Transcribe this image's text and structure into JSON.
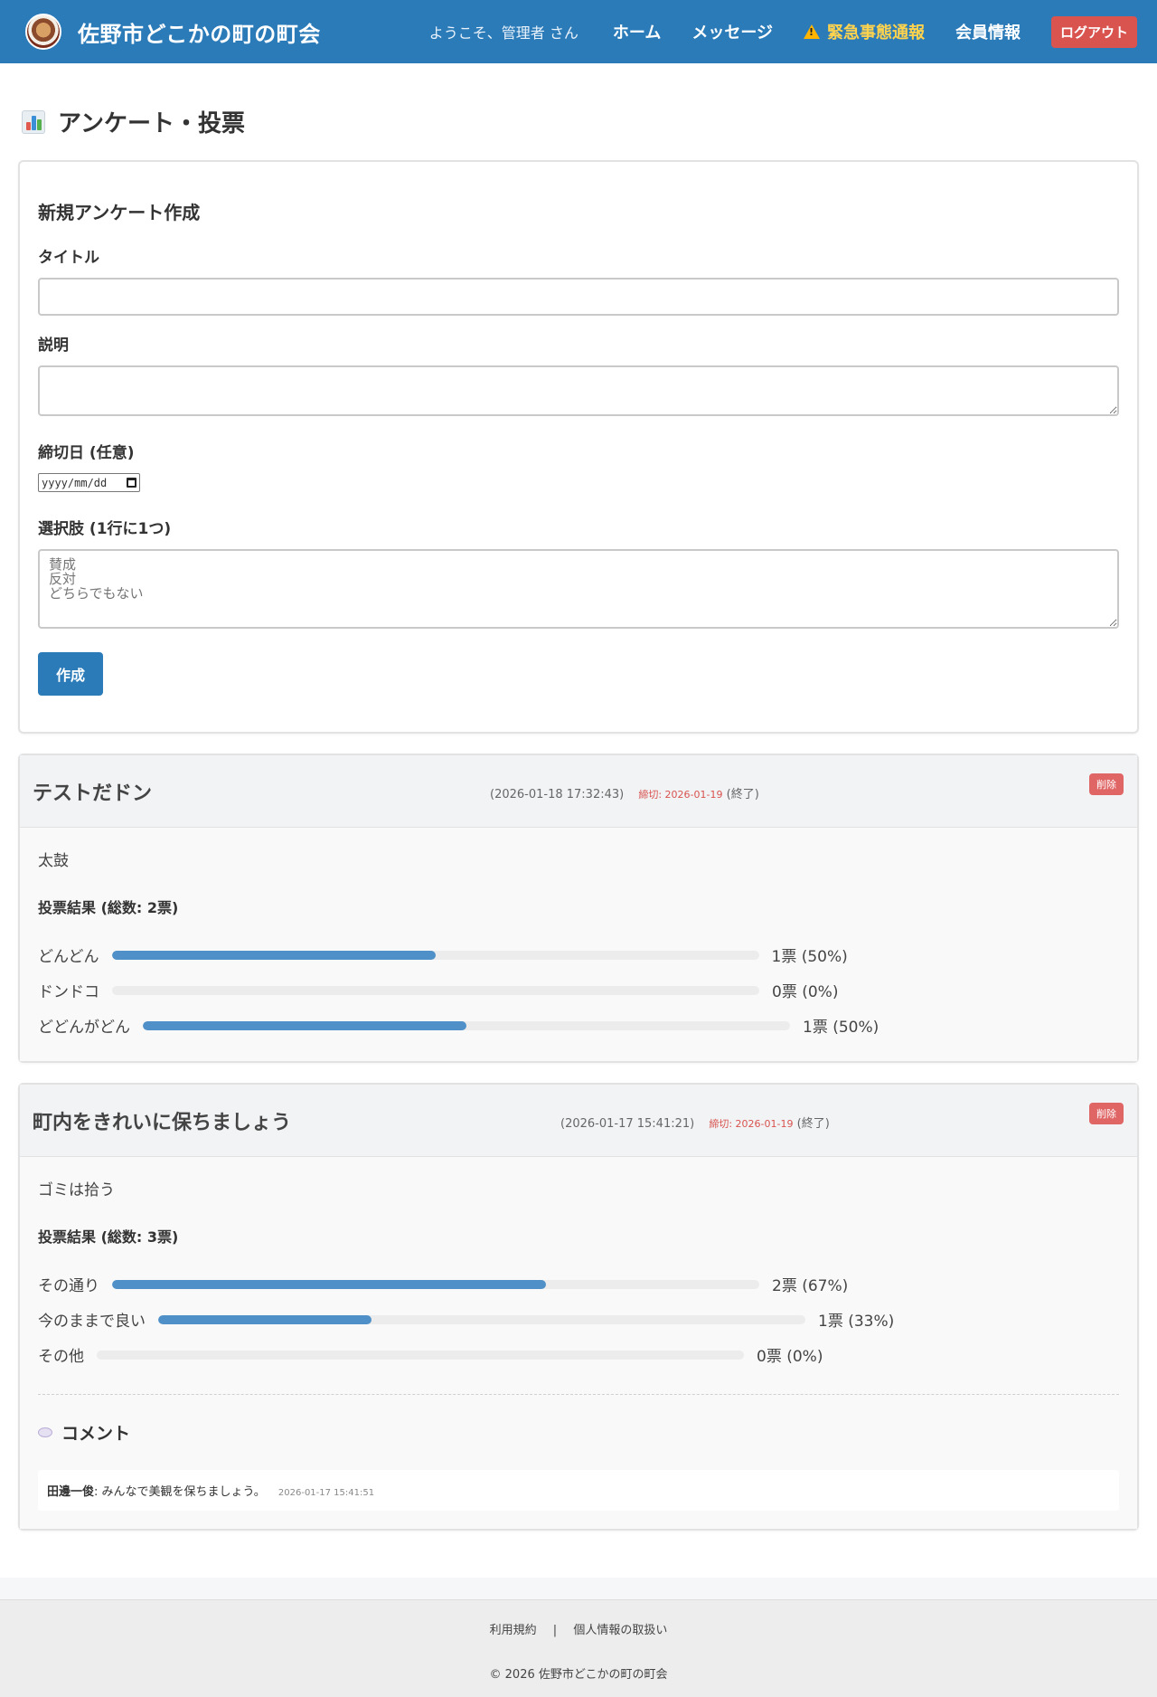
{
  "header": {
    "site_title": "佐野市どこかの町の町会",
    "welcome": "ようこそ、管理者 さん",
    "nav": {
      "home": "ホーム",
      "messages": "メッセージ",
      "emergency": "緊急事態通報",
      "members": "会員情報",
      "logout": "ログアウト"
    }
  },
  "page": {
    "title": "アンケート・投票"
  },
  "form": {
    "heading": "新規アンケート作成",
    "title_label": "タイトル",
    "title_value": "",
    "desc_label": "説明",
    "desc_value": "",
    "deadline_label": "締切日 (任意)",
    "deadline_placeholder": "yyyy/mm/dd",
    "options_label": "選択肢 (1行に1つ)",
    "options_placeholder": "賛成\n反対\nどちらでもない",
    "submit_label": "作成"
  },
  "polls": [
    {
      "title": "テストだドン",
      "created": "(2026-01-18 17:32:43)",
      "deadline": "締切: 2026-01-19",
      "status": "(終了)",
      "delete_label": "削除",
      "description": "太鼓",
      "results_heading": "投票結果 (総数: 2票)",
      "results": [
        {
          "label": "どんどん",
          "value_text": "1票 (50%)",
          "percent": 50
        },
        {
          "label": "ドンドコ",
          "value_text": "0票 (0%)",
          "percent": 0
        },
        {
          "label": "どどんがどん",
          "value_text": "1票 (50%)",
          "percent": 50
        }
      ]
    },
    {
      "title": "町内をきれいに保ちましょう",
      "created": "(2026-01-17 15:41:21)",
      "deadline": "締切: 2026-01-19",
      "status": "(終了)",
      "delete_label": "削除",
      "description": "ゴミは拾う",
      "results_heading": "投票結果 (総数: 3票)",
      "results": [
        {
          "label": "その通り",
          "value_text": "2票 (67%)",
          "percent": 67
        },
        {
          "label": "今のままで良い",
          "value_text": "1票 (33%)",
          "percent": 33
        },
        {
          "label": "その他",
          "value_text": "0票 (0%)",
          "percent": 0
        }
      ],
      "comments_heading": "コメント",
      "comments": [
        {
          "author": "田邊一俊",
          "text": ": みんなで美観を保ちましょう。",
          "time": "2026-01-17 15:41:51"
        }
      ]
    }
  ],
  "footer": {
    "terms": "利用規約",
    "separator": "|",
    "privacy": "個人情報の取扱い",
    "copyright": "© 2026 佐野市どこかの町の町会"
  },
  "colors": {
    "header_bg": "#2b7bb9",
    "emergency": "#ffd34d",
    "logout_bg": "#d9534f",
    "bar_fill": "#4f90c9",
    "deadline": "#d9534f"
  }
}
